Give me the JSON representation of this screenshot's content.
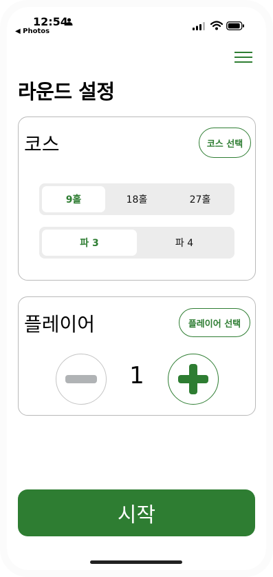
{
  "status_bar": {
    "time": "12:54",
    "back_label": "◀ Photos"
  },
  "header": {
    "title": "라운드 설정",
    "menu_icon": "hamburger-menu-icon"
  },
  "course": {
    "title": "코스",
    "select_label": "코스 선택",
    "holes": [
      "9홀",
      "18홀",
      "27홀"
    ],
    "selected_holes": "9홀",
    "pars": [
      "파 3",
      "파 4"
    ],
    "selected_par": "파 3"
  },
  "players": {
    "title": "플레이어",
    "select_label": "플레이어 선택",
    "count": "1",
    "decrement_icon": "minus-icon",
    "increment_icon": "plus-icon"
  },
  "start_label": "시작",
  "colors": {
    "accent": "#2e7d32",
    "segment_bg": "#ececec",
    "disabled": "#b0b3b5"
  }
}
